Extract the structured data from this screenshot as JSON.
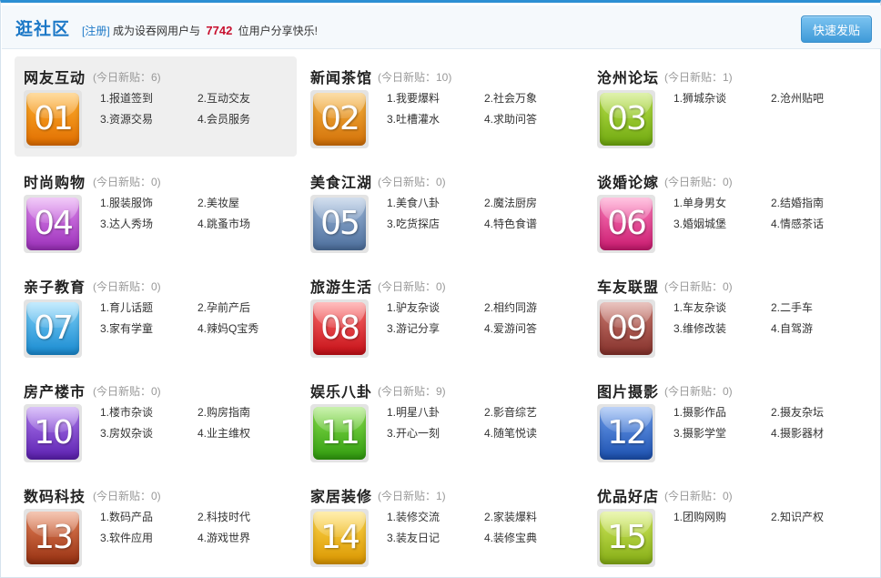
{
  "header": {
    "title": "逛社区",
    "register_label": "[注册]",
    "note_before": "成为设吞网用户与",
    "user_count": "7742",
    "note_after": "位用户分享快乐!",
    "post_button_label": "快速发贴"
  },
  "colors": {
    "accent": "#1d79c7",
    "count_red": "#c8102e",
    "tile_01": "#ef8a10",
    "tile_02": "#e68a14",
    "tile_03": "#8bc61f",
    "tile_04": "#b64fd0",
    "tile_05": "#5f82b3",
    "tile_06": "#e33e8e",
    "tile_07": "#27a6e4",
    "tile_08": "#e02a2a",
    "tile_09": "#a2443c",
    "tile_10": "#7c3fc8",
    "tile_11": "#4cb41c",
    "tile_12": "#2a66c7",
    "tile_13": "#b6451e",
    "tile_14": "#f0b615",
    "tile_15": "#9fc322"
  },
  "forums": [
    {
      "num": "01",
      "title": "网友互动",
      "new_posts": "(今日新贴：6)",
      "links": [
        "1.报道签到",
        "2.互动交友",
        "3.资源交易",
        "4.会员服务"
      ]
    },
    {
      "num": "02",
      "title": "新闻茶馆",
      "new_posts": "(今日新贴：10)",
      "links": [
        "1.我要爆料",
        "2.社会万象",
        "3.吐槽灌水",
        "4.求助问答"
      ]
    },
    {
      "num": "03",
      "title": "沧州论坛",
      "new_posts": "(今日新贴：1)",
      "links": [
        "1.狮城杂谈",
        "2.沧州贴吧"
      ]
    },
    {
      "num": "04",
      "title": "时尚购物",
      "new_posts": "(今日新贴：0)",
      "links": [
        "1.服装服饰",
        "2.美妆屋",
        "3.达人秀场",
        "4.跳蚤市场"
      ]
    },
    {
      "num": "05",
      "title": "美食江湖",
      "new_posts": "(今日新贴：0)",
      "links": [
        "1.美食八卦",
        "2.魔法厨房",
        "3.吃货探店",
        "4.特色食谱"
      ]
    },
    {
      "num": "06",
      "title": "谈婚论嫁",
      "new_posts": "(今日新贴：0)",
      "links": [
        "1.单身男女",
        "2.结婚指南",
        "3.婚姻城堡",
        "4.情感茶话"
      ]
    },
    {
      "num": "07",
      "title": "亲子教育",
      "new_posts": "(今日新贴：0)",
      "links": [
        "1.育儿话题",
        "2.孕前产后",
        "3.家有学童",
        "4.辣妈Q宝秀"
      ]
    },
    {
      "num": "08",
      "title": "旅游生活",
      "new_posts": "(今日新贴：0)",
      "links": [
        "1.驴友杂谈",
        "2.相约同游",
        "3.游记分享",
        "4.爱游问答"
      ]
    },
    {
      "num": "09",
      "title": "车友联盟",
      "new_posts": "(今日新贴：0)",
      "links": [
        "1.车友杂谈",
        "2.二手车",
        "3.维修改装",
        "4.自驾游"
      ]
    },
    {
      "num": "10",
      "title": "房产楼市",
      "new_posts": "(今日新贴：0)",
      "links": [
        "1.楼市杂谈",
        "2.购房指南",
        "3.房奴杂谈",
        "4.业主维权"
      ]
    },
    {
      "num": "11",
      "title": "娱乐八卦",
      "new_posts": "(今日新贴：9)",
      "links": [
        "1.明星八卦",
        "2.影音综艺",
        "3.开心一刻",
        "4.随笔悦读"
      ]
    },
    {
      "num": "12",
      "title": "图片摄影",
      "new_posts": "(今日新贴：0)",
      "links": [
        "1.摄影作品",
        "2.摄友杂坛",
        "3.摄影学堂",
        "4.摄影器材"
      ]
    },
    {
      "num": "13",
      "title": "数码科技",
      "new_posts": "(今日新贴：0)",
      "links": [
        "1.数码产品",
        "2.科技时代",
        "3.软件应用",
        "4.游戏世界"
      ]
    },
    {
      "num": "14",
      "title": "家居装修",
      "new_posts": "(今日新贴：1)",
      "links": [
        "1.装修交流",
        "2.家装爆料",
        "3.装友日记",
        "4.装修宝典"
      ]
    },
    {
      "num": "15",
      "title": "优品好店",
      "new_posts": "(今日新贴：0)",
      "links": [
        "1.团购网购",
        "2.知识产权"
      ]
    }
  ]
}
